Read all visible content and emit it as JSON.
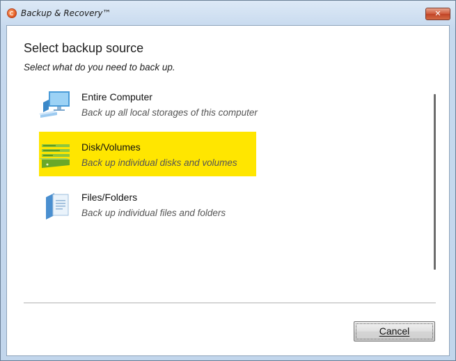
{
  "window": {
    "title": "Backup & Recovery™",
    "close_label": "✕",
    "app_icon": "app-logo-icon"
  },
  "main": {
    "heading": "Select backup source",
    "subheading": "Select what do you need to back up.",
    "options": [
      {
        "title": "Entire Computer",
        "description": "Back up all local storages of this computer",
        "icon": "computer-icon",
        "selected": false
      },
      {
        "title": "Disk/Volumes",
        "description": "Back up individual disks and volumes",
        "icon": "disk-volumes-icon",
        "selected": true
      },
      {
        "title": "Files/Folders",
        "description": "Back up individual files and folders",
        "icon": "files-folders-icon",
        "selected": false
      }
    ]
  },
  "footer": {
    "cancel_label": "Cancel"
  },
  "colors": {
    "selection": "#ffe600",
    "accent_blue": "#4a9bd8",
    "accent_green": "#7cc02a"
  }
}
